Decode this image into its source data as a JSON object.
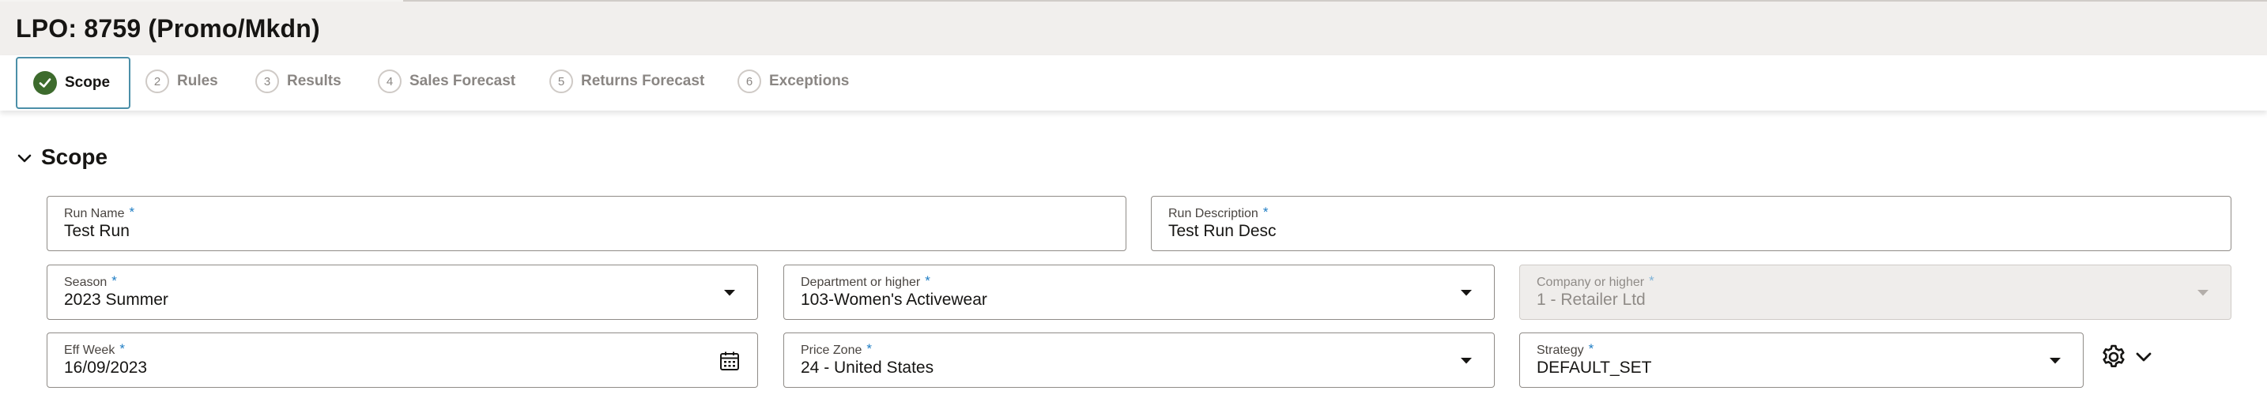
{
  "page": {
    "title": "LPO: 8759 (Promo/Mkdn)"
  },
  "train": {
    "steps": [
      {
        "number": "",
        "label": "Scope",
        "state": "completed-active",
        "icon": "check-icon"
      },
      {
        "number": "2",
        "label": "Rules",
        "state": "inactive"
      },
      {
        "number": "3",
        "label": "Results",
        "state": "inactive"
      },
      {
        "number": "4",
        "label": "Sales Forecast",
        "state": "inactive"
      },
      {
        "number": "5",
        "label": "Returns Forecast",
        "state": "inactive"
      },
      {
        "number": "6",
        "label": "Exceptions",
        "state": "inactive"
      }
    ]
  },
  "section": {
    "title": "Scope",
    "toggle_icon": "chevron-down-icon"
  },
  "form": {
    "run_name": {
      "label": "Run Name",
      "required": "*",
      "value": "Test Run"
    },
    "run_description": {
      "label": "Run Description",
      "required": "*",
      "value": "Test Run Desc"
    },
    "season": {
      "label": "Season",
      "required": "*",
      "value": "2023 Summer",
      "icon": "chevron-down-icon"
    },
    "department": {
      "label": "Department or higher",
      "required": "*",
      "value": "103-Women's Activewear",
      "icon": "chevron-down-icon"
    },
    "company": {
      "label": "Company or higher",
      "required": "*",
      "value": "1 - Retailer Ltd",
      "icon": "chevron-down-icon",
      "disabled": true
    },
    "eff_week": {
      "label": "Eff Week",
      "required": "*",
      "value": "16/09/2023",
      "icon": "calendar-icon"
    },
    "price_zone": {
      "label": "Price Zone",
      "required": "*",
      "value": "24 - United States",
      "icon": "chevron-down-icon"
    },
    "strategy": {
      "label": "Strategy",
      "required": "*",
      "value": "DEFAULT_SET",
      "icon": "chevron-down-icon"
    }
  },
  "actions": {
    "settings_icon": "gear-icon",
    "settings_menu_icon": "chevron-down-icon"
  },
  "colors": {
    "header_bg": "#f1efed",
    "active_step_border": "#4b8fa8",
    "completed_check": "#3d6b2d",
    "required_marker": "#1f7dc4",
    "field_border": "#8f8b87"
  }
}
